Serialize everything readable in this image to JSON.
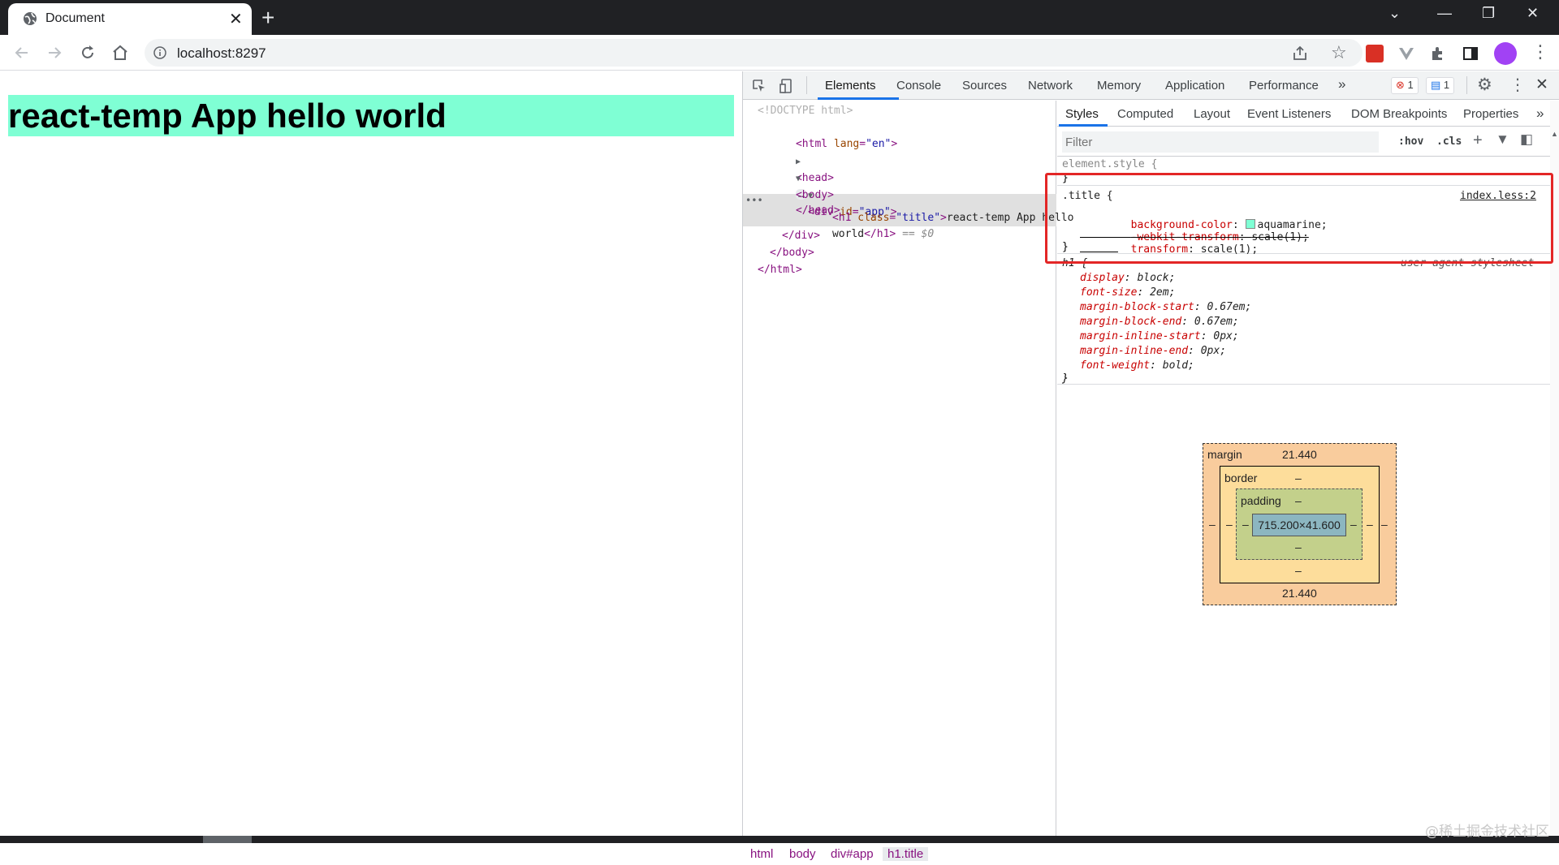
{
  "browser": {
    "tab_title": "Document",
    "url": "localhost:8297"
  },
  "page": {
    "heading": "react-temp App hello world",
    "heading_bg": "#7fffd4"
  },
  "devtools": {
    "tabs": [
      "Elements",
      "Console",
      "Sources",
      "Network",
      "Memory",
      "Application",
      "Performance"
    ],
    "more_tabs": "»",
    "errors_count": "1",
    "messages_count": "1",
    "dom": {
      "doctype": "<!DOCTYPE html>",
      "html_open_tag": "html",
      "html_attr": "lang",
      "html_attr_val": "\"en\"",
      "head_tag": "<head>",
      "head_close": "</head>",
      "body_open": "<body>",
      "div_open_tag": "div",
      "div_attr": "id",
      "div_attr_val": "\"app\"",
      "h1_open_tag": "h1",
      "h1_attr": "class",
      "h1_attr_val": "\"title\"",
      "h1_text_1": "react-temp App hello",
      "h1_text_2": "world",
      "h1_close": "</h1>",
      "h1_eq": "== $0",
      "div_close": "</div>",
      "body_close": "</body>",
      "html_close": "</html>",
      "ellipsis": "…"
    },
    "breadcrumbs": [
      "html",
      "body",
      "div#app",
      "h1.title"
    ],
    "side_tabs": [
      "Styles",
      "Computed",
      "Layout",
      "Event Listeners",
      "DOM Breakpoints",
      "Properties"
    ],
    "filter_placeholder": "Filter",
    "filter_hov": ":hov",
    "filter_cls": ".cls",
    "styles": {
      "element_style_open": "element.style {",
      "close_brace": "}",
      "title_selector": ".title {",
      "title_source": "index.less:2",
      "title_props": [
        {
          "name": "background-color",
          "value": "aquamarine;",
          "swatch": "#7fffd4"
        },
        {
          "name": "-webkit-transform",
          "value": "scale(1);",
          "struck": true
        },
        {
          "name": "transform",
          "value": "scale(1);"
        }
      ],
      "ua_selector": "h1 {",
      "ua_source": "user agent stylesheet",
      "ua_props": [
        {
          "name": "display",
          "value": "block;"
        },
        {
          "name": "font-size",
          "value": "2em;"
        },
        {
          "name": "margin-block-start",
          "value": "0.67em;"
        },
        {
          "name": "margin-block-end",
          "value": "0.67em;"
        },
        {
          "name": "margin-inline-start",
          "value": "0px;"
        },
        {
          "name": "margin-inline-end",
          "value": "0px;"
        },
        {
          "name": "font-weight",
          "value": "bold;"
        }
      ]
    },
    "box_model": {
      "margin_label": "margin",
      "margin_top": "21.440",
      "margin_bottom": "21.440",
      "margin_side": "–",
      "border_label": "border",
      "border_value": "–",
      "padding_label": "padding",
      "padding_value": "–",
      "content": "715.200×41.600"
    }
  },
  "watermark": "@稀土掘金技术社区"
}
